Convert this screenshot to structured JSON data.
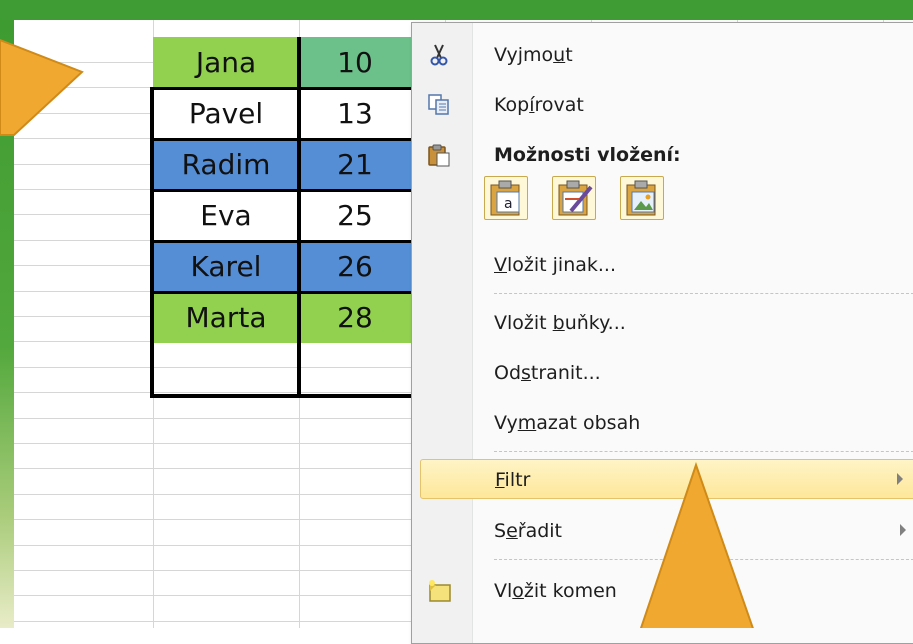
{
  "table": {
    "rows": [
      {
        "name": "Jana",
        "value": "10",
        "color": "#92d050"
      },
      {
        "name": "Pavel",
        "value": "13",
        "color": "#ffffff"
      },
      {
        "name": "Radim",
        "value": "21",
        "color": "#558ed5"
      },
      {
        "name": "Eva",
        "value": "25",
        "color": "#ffffff"
      },
      {
        "name": "Karel",
        "value": "26",
        "color": "#558ed5"
      },
      {
        "name": "Marta",
        "value": "28",
        "color": "#92d050"
      }
    ]
  },
  "menu": {
    "cut": {
      "pre": "Vyjmo",
      "key": "u",
      "post": "t",
      "icon": "scissors-icon"
    },
    "copy": {
      "pre": "Kop",
      "key": "í",
      "post": "rovat",
      "icon": "copy-icon"
    },
    "paste_options_title": "Možnosti vložení:",
    "paste_options_icon": "clipboard-icon",
    "paste_buttons": [
      "paste-values-icon",
      "paste-formatting-icon",
      "paste-picture-icon"
    ],
    "paste_special": {
      "pre": "",
      "key": "V",
      "post": "ložit jinak..."
    },
    "insert_cells": {
      "pre": "Vložit ",
      "key": "b",
      "post": "uňky..."
    },
    "delete": {
      "pre": "Od",
      "key": "s",
      "post": "tranit..."
    },
    "clear_contents": {
      "pre": "Vy",
      "key": "m",
      "post": "azat obsah"
    },
    "filter": {
      "pre": "",
      "key": "F",
      "post": "iltr"
    },
    "sort": {
      "pre": "S",
      "key": "e",
      "post": "řadit"
    },
    "insert_comment": {
      "pre": "Vl",
      "key": "o",
      "post": "žit komen",
      "icon": "comment-icon"
    }
  },
  "colors": {
    "frame_green": "#3f9c34",
    "callout_orange": "#f0a830",
    "highlight": "#fde79a"
  }
}
